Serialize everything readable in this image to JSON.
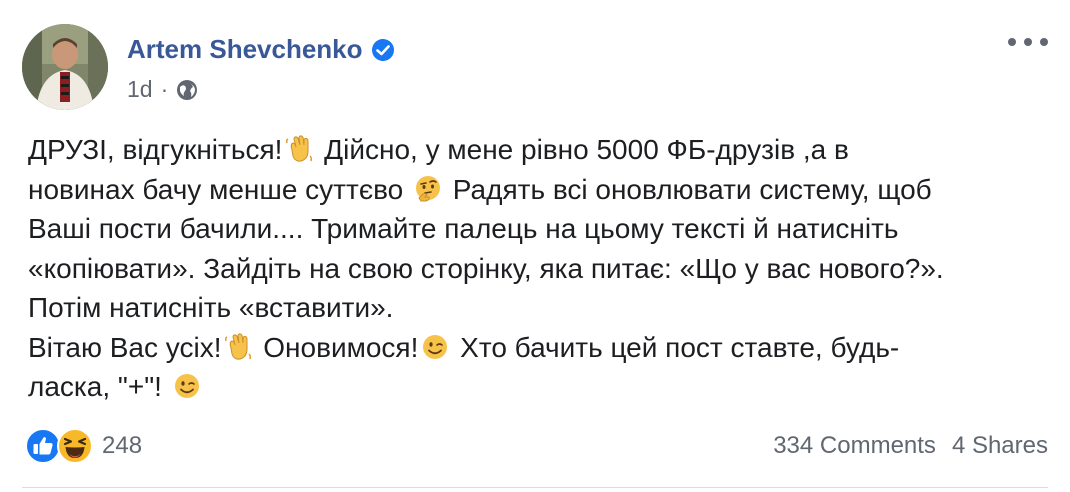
{
  "post": {
    "author": "Artem Shevchenko",
    "verified": true,
    "timestamp": "1d",
    "separator": "·",
    "privacy_icon": "globe-icon",
    "menu_icon": "more-options-icon",
    "lines": [
      [
        {
          "t": "ДРУЗІ, відгукніться!"
        },
        {
          "e": "waving-hand-emoji"
        },
        {
          "t": " Дійсно, у мене рівно 5000 ФБ-друзів ,а в"
        }
      ],
      [
        {
          "t": "новинах бачу менше суттєво "
        },
        {
          "e": "thinking-face-emoji"
        },
        {
          "t": " Радять всі оновлювати систему, щоб"
        }
      ],
      [
        {
          "t": "Ваші пости бачили.... Тримайте палець на цьому тексті й натисніть"
        }
      ],
      [
        {
          "t": "«копіювати». Зайдіть на свою сторінку, яка питає: «Що у вас нового?»."
        }
      ],
      [
        {
          "t": "Потім натисніть «вставити»."
        }
      ],
      [
        {
          "t": "Вітаю Вас усіх!"
        },
        {
          "e": "waving-hand-emoji"
        },
        {
          "t": " Оновимося!"
        },
        {
          "e": "winking-face-emoji"
        },
        {
          "t": " Хто бачить цей пост ставте, будь-"
        }
      ],
      [
        {
          "t": "ласка, \"+\"! "
        },
        {
          "e": "winking-face-emoji"
        }
      ]
    ]
  },
  "footer": {
    "reaction_icons": [
      "like-icon",
      "haha-icon"
    ],
    "reaction_count": "248",
    "comments": "334 Comments",
    "shares": "4 Shares"
  },
  "colors": {
    "author": "#385898",
    "meta": "#606770",
    "text": "#1c1e21",
    "like_blue": "#1877f2",
    "emoji_yellow": "#f7b928"
  }
}
